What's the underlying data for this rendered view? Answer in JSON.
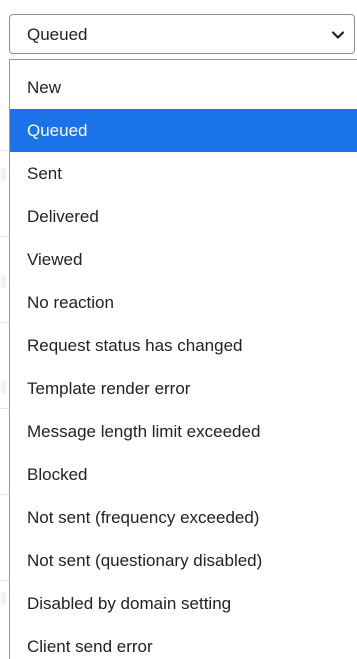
{
  "select": {
    "value": "Queued",
    "icon": "chevron-down-icon"
  },
  "options": [
    {
      "label": "New",
      "selected": false
    },
    {
      "label": "Queued",
      "selected": true
    },
    {
      "label": "Sent",
      "selected": false
    },
    {
      "label": "Delivered",
      "selected": false
    },
    {
      "label": "Viewed",
      "selected": false
    },
    {
      "label": "No reaction",
      "selected": false
    },
    {
      "label": "Request status has changed",
      "selected": false
    },
    {
      "label": "Template render error",
      "selected": false
    },
    {
      "label": "Message length limit exceeded",
      "selected": false
    },
    {
      "label": "Blocked",
      "selected": false
    },
    {
      "label": "Not sent (frequency exceeded)",
      "selected": false
    },
    {
      "label": "Not sent (questionary disabled)",
      "selected": false
    },
    {
      "label": "Disabled by domain setting",
      "selected": false
    },
    {
      "label": "Client send error",
      "selected": false
    }
  ],
  "colors": {
    "selected_background": "#1a73e8",
    "selected_text": "#ffffff",
    "text": "#222222",
    "border": "#8f8f8f"
  }
}
